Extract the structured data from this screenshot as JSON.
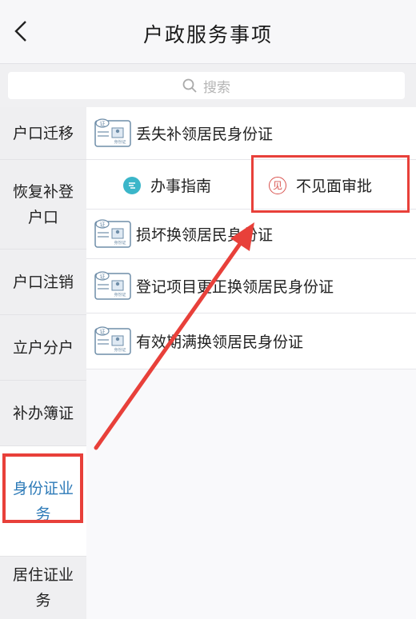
{
  "header": {
    "title": "户政服务事项",
    "back_icon": "chevron-left-icon"
  },
  "search": {
    "placeholder": "搜索"
  },
  "sidebar": {
    "items": [
      {
        "label": "户口迁移"
      },
      {
        "label": "恢复补登户口"
      },
      {
        "label": "户口注销"
      },
      {
        "label": "立户分户"
      },
      {
        "label": "补办簿证"
      },
      {
        "label": "身份证业务",
        "active": true
      },
      {
        "label": "居住证业务"
      }
    ]
  },
  "services": [
    {
      "label": "丢失补领居民身份证",
      "icon": "id-card-icon"
    },
    {
      "label": "损坏换领居民身份证",
      "icon": "id-card-icon"
    },
    {
      "label": "登记项目更正换领居民身份证",
      "icon": "id-card-icon"
    },
    {
      "label": "有效期满换领居民身份证",
      "icon": "id-card-icon"
    }
  ],
  "service_actions": {
    "guide_label": "办事指南",
    "approval_label": "不见面审批"
  },
  "icon_glyphs": {
    "card_tag": "证",
    "card_caption": "身份证",
    "approval_glyph": "见"
  },
  "colors": {
    "accent": "#2e7bb8",
    "annotation": "#e8403a",
    "guide_icon": "#3bb6c9",
    "approval_icon": "#d9534f"
  }
}
